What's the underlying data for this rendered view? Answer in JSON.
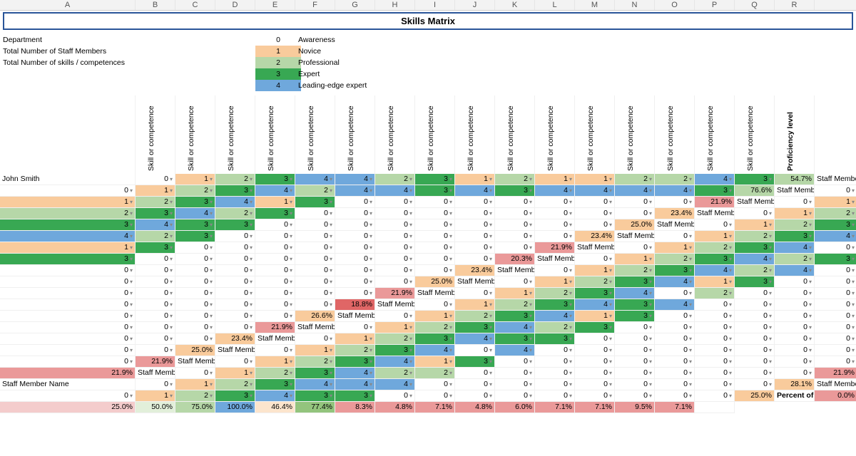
{
  "columns": [
    "A",
    "B",
    "C",
    "D",
    "E",
    "F",
    "G",
    "H",
    "I",
    "J",
    "K",
    "L",
    "M",
    "N",
    "O",
    "P",
    "Q",
    "R"
  ],
  "title": "Skills Matrix",
  "meta_labels": {
    "department": "Department",
    "staff_total": "Total Number of Staff Members",
    "skills_total": "Total Number of skills / competences"
  },
  "legend": [
    {
      "n": "0",
      "label": "Awareness",
      "cls": "legend-0"
    },
    {
      "n": "1",
      "label": "Novice",
      "cls": "legend-1"
    },
    {
      "n": "2",
      "label": "Professional",
      "cls": "legend-2"
    },
    {
      "n": "3",
      "label": "Expert",
      "cls": "legend-3"
    },
    {
      "n": "4",
      "label": "Leading-edge expert",
      "cls": "legend-4"
    }
  ],
  "skill_header": "Skill or competence",
  "prof_header": "Proficiency level",
  "staff": [
    {
      "name": "John Smith",
      "vals": [
        0,
        1,
        2,
        3,
        4,
        4,
        2,
        3,
        1,
        2,
        1,
        1,
        2,
        2,
        4,
        3
      ],
      "prof": "54.7%",
      "pcls": "pband-high"
    },
    {
      "name": "Staff Member Name",
      "vals": [
        0,
        1,
        2,
        3,
        4,
        2,
        4,
        4,
        3,
        4,
        3,
        4,
        4,
        4,
        4,
        3
      ],
      "prof": "76.6%",
      "pcls": "pband-high"
    },
    {
      "name": "Staff Member Name",
      "vals": [
        0,
        1,
        2,
        3,
        4,
        1,
        3,
        0,
        0,
        0,
        0,
        0,
        0,
        0,
        0,
        0
      ],
      "prof": "21.9%",
      "pcls": "pband-low"
    },
    {
      "name": "Staff Member Name",
      "vals": [
        0,
        1,
        2,
        3,
        4,
        2,
        3,
        0,
        0,
        0,
        0,
        0,
        0,
        0,
        0,
        0
      ],
      "prof": "23.4%",
      "pcls": "pband-mid"
    },
    {
      "name": "Staff Member Name",
      "vals": [
        0,
        1,
        2,
        3,
        4,
        3,
        3,
        0,
        0,
        0,
        0,
        0,
        0,
        0,
        0,
        0
      ],
      "prof": "25.0%",
      "pcls": "pband-mid"
    },
    {
      "name": "Staff Member Name",
      "vals": [
        0,
        1,
        2,
        3,
        4,
        2,
        3,
        0,
        0,
        0,
        0,
        0,
        0,
        0,
        0,
        0
      ],
      "prof": "23.4%",
      "pcls": "pband-mid"
    },
    {
      "name": "Staff Member Name",
      "vals": [
        0,
        1,
        2,
        3,
        4,
        1,
        3,
        0,
        0,
        0,
        0,
        0,
        0,
        0,
        0,
        0
      ],
      "prof": "21.9%",
      "pcls": "pband-low"
    },
    {
      "name": "Staff Member Name",
      "vals": [
        0,
        1,
        2,
        3,
        4,
        0,
        3,
        0,
        0,
        0,
        0,
        0,
        0,
        0,
        0,
        0
      ],
      "prof": "20.3%",
      "pcls": "pband-low"
    },
    {
      "name": "Staff Member Name",
      "vals": [
        0,
        1,
        2,
        3,
        4,
        2,
        3,
        0,
        0,
        0,
        0,
        0,
        0,
        0,
        0,
        0
      ],
      "prof": "23.4%",
      "pcls": "pband-mid"
    },
    {
      "name": "Staff Member Name",
      "vals": [
        0,
        1,
        2,
        3,
        4,
        2,
        4,
        0,
        0,
        0,
        0,
        0,
        0,
        0,
        0,
        0
      ],
      "prof": "25.0%",
      "pcls": "pband-mid"
    },
    {
      "name": "Staff Member Name",
      "vals": [
        0,
        1,
        2,
        3,
        4,
        1,
        3,
        0,
        0,
        0,
        0,
        0,
        0,
        0,
        0,
        0
      ],
      "prof": "21.9%",
      "pcls": "pband-low"
    },
    {
      "name": "Staff Member Name",
      "vals": [
        0,
        1,
        2,
        3,
        4,
        0,
        2,
        0,
        0,
        0,
        0,
        0,
        0,
        0,
        0,
        0
      ],
      "prof": "18.8%",
      "pcls": "pband-vlow"
    },
    {
      "name": "Staff Member Name",
      "vals": [
        0,
        1,
        2,
        3,
        4,
        3,
        4,
        0,
        0,
        0,
        0,
        0,
        0,
        0,
        0,
        0
      ],
      "prof": "26.6%",
      "pcls": "pband-mid"
    },
    {
      "name": "Staff Member Name",
      "vals": [
        0,
        1,
        2,
        3,
        4,
        1,
        3,
        0,
        0,
        0,
        0,
        0,
        0,
        0,
        0,
        0
      ],
      "prof": "21.9%",
      "pcls": "pband-low"
    },
    {
      "name": "Staff Member Name",
      "vals": [
        0,
        1,
        2,
        3,
        4,
        2,
        3,
        0,
        0,
        0,
        0,
        0,
        0,
        0,
        0,
        0
      ],
      "prof": "23.4%",
      "pcls": "pband-mid"
    },
    {
      "name": "Staff Member Name",
      "vals": [
        0,
        1,
        2,
        3,
        4,
        3,
        3,
        0,
        0,
        0,
        0,
        0,
        0,
        0,
        0,
        0
      ],
      "prof": "25.0%",
      "pcls": "pband-mid"
    },
    {
      "name": "Staff Member Name",
      "vals": [
        0,
        1,
        2,
        3,
        4,
        0,
        4,
        0,
        0,
        0,
        0,
        0,
        0,
        0,
        0,
        0
      ],
      "prof": "21.9%",
      "pcls": "pband-low"
    },
    {
      "name": "Staff Member Name",
      "vals": [
        0,
        1,
        2,
        3,
        4,
        1,
        3,
        0,
        0,
        0,
        0,
        0,
        0,
        0,
        0,
        0
      ],
      "prof": "21.9%",
      "pcls": "pband-low"
    },
    {
      "name": "Staff Member Name",
      "vals": [
        0,
        1,
        2,
        3,
        4,
        2,
        2,
        0,
        0,
        0,
        0,
        0,
        0,
        0,
        0,
        0
      ],
      "prof": "21.9%",
      "pcls": "pband-low"
    },
    {
      "name": "Staff Member Name",
      "vals": [
        0,
        1,
        2,
        3,
        4,
        4,
        4,
        0,
        0,
        0,
        0,
        0,
        0,
        0,
        0,
        0
      ],
      "prof": "28.1%",
      "pcls": "pband-mid"
    },
    {
      "name": "Staff Member Name",
      "vals": [
        0,
        1,
        2,
        3,
        4,
        3,
        3,
        0,
        0,
        0,
        0,
        0,
        0,
        0,
        0,
        0
      ],
      "prof": "25.0%",
      "pcls": "pband-mid"
    }
  ],
  "footer": {
    "label": "Percent of skill coverage",
    "vals": [
      {
        "t": "0.0%",
        "c": "cov-red"
      },
      {
        "t": "25.0%",
        "c": "cov-lt"
      },
      {
        "t": "50.0%",
        "c": "cov-yel2"
      },
      {
        "t": "75.0%",
        "c": "cov-grn"
      },
      {
        "t": "100.0%",
        "c": "cov-blue"
      },
      {
        "t": "46.4%",
        "c": "cov-or"
      },
      {
        "t": "77.4%",
        "c": "cov-dgrn"
      },
      {
        "t": "8.3%",
        "c": "cov-red"
      },
      {
        "t": "4.8%",
        "c": "cov-red"
      },
      {
        "t": "7.1%",
        "c": "cov-red"
      },
      {
        "t": "4.8%",
        "c": "cov-red"
      },
      {
        "t": "6.0%",
        "c": "cov-red"
      },
      {
        "t": "7.1%",
        "c": "cov-red"
      },
      {
        "t": "7.1%",
        "c": "cov-red"
      },
      {
        "t": "9.5%",
        "c": "cov-red"
      },
      {
        "t": "7.1%",
        "c": "cov-red"
      }
    ]
  }
}
